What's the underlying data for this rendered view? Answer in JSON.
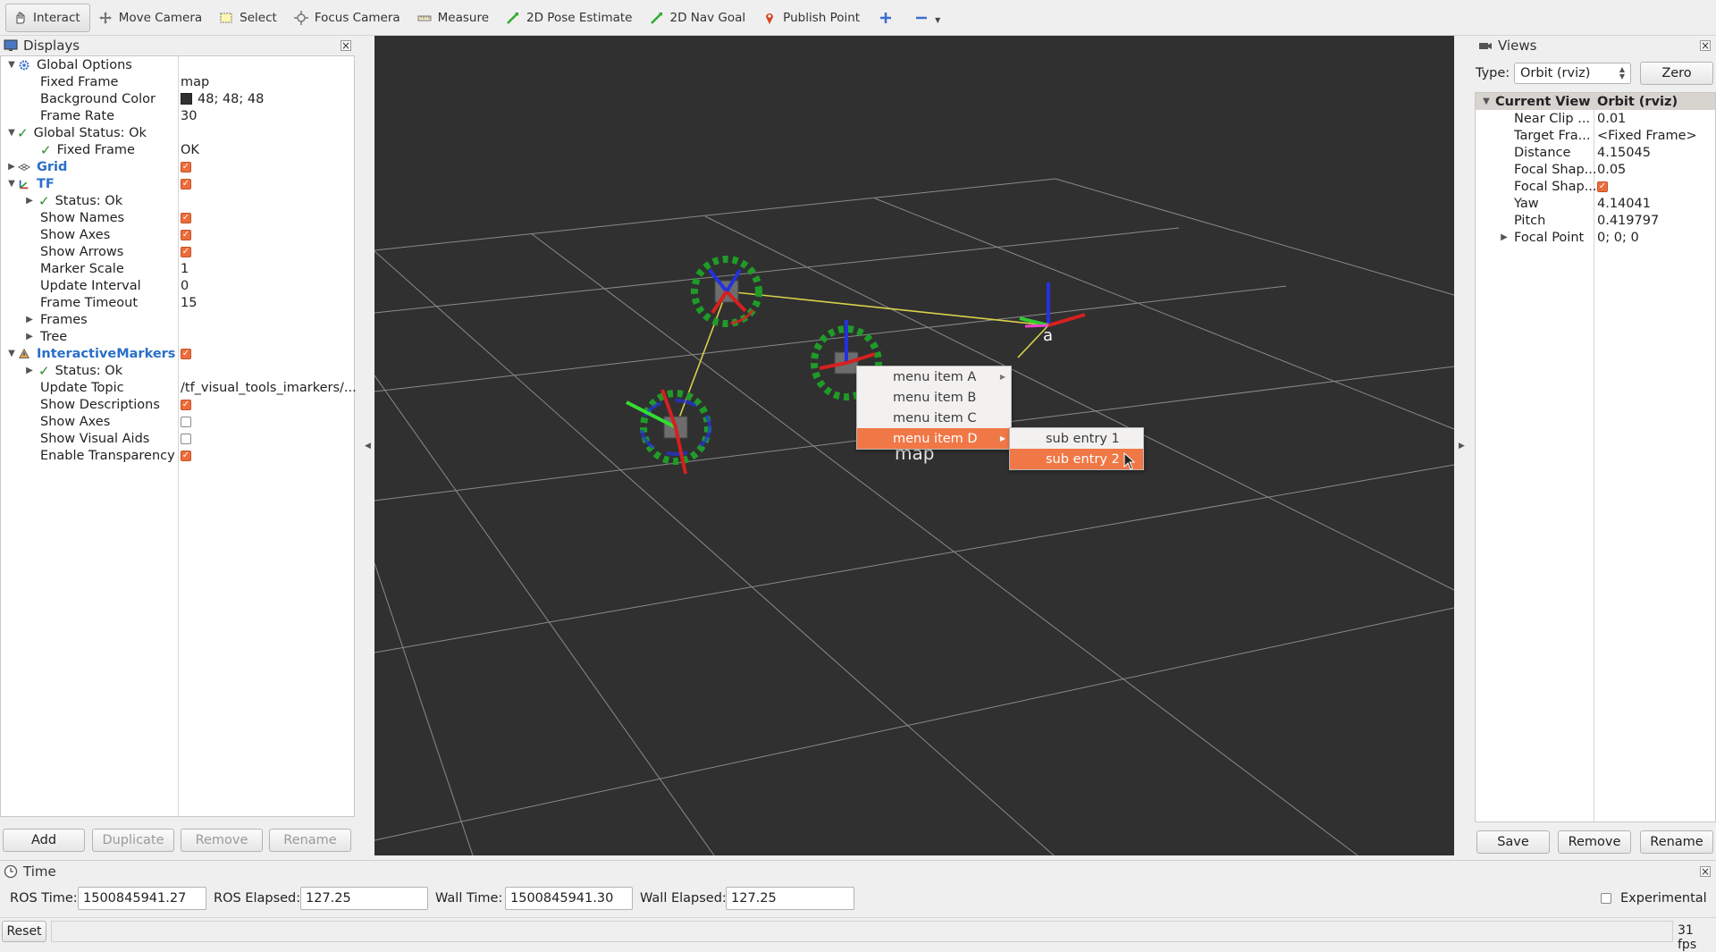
{
  "toolbar": {
    "tools": [
      {
        "label": "Interact",
        "icon": "hand-icon"
      },
      {
        "label": "Move Camera",
        "icon": "move-camera-icon"
      },
      {
        "label": "Select",
        "icon": "select-icon"
      },
      {
        "label": "Focus Camera",
        "icon": "focus-camera-icon"
      },
      {
        "label": "Measure",
        "icon": "measure-icon"
      },
      {
        "label": "2D Pose Estimate",
        "icon": "pose-estimate-icon"
      },
      {
        "label": "2D Nav Goal",
        "icon": "nav-goal-icon"
      },
      {
        "label": "Publish Point",
        "icon": "publish-point-icon"
      }
    ]
  },
  "displays": {
    "title": "Displays",
    "rows": [
      {
        "name": "Global Options",
        "value": ""
      },
      {
        "name": "Fixed Frame",
        "value": "map"
      },
      {
        "name": "Background Color",
        "value": "48; 48; 48"
      },
      {
        "name": "Frame Rate",
        "value": "30"
      },
      {
        "name": "Global Status: Ok",
        "value": ""
      },
      {
        "name": "Fixed Frame",
        "value": "OK"
      },
      {
        "name": "Grid",
        "value": ""
      },
      {
        "name": "TF",
        "value": ""
      },
      {
        "name": "Status: Ok",
        "value": ""
      },
      {
        "name": "Show Names",
        "value": ""
      },
      {
        "name": "Show Axes",
        "value": ""
      },
      {
        "name": "Show Arrows",
        "value": ""
      },
      {
        "name": "Marker Scale",
        "value": "1"
      },
      {
        "name": "Update Interval",
        "value": "0"
      },
      {
        "name": "Frame Timeout",
        "value": "15"
      },
      {
        "name": "Frames",
        "value": ""
      },
      {
        "name": "Tree",
        "value": ""
      },
      {
        "name": "InteractiveMarkers",
        "value": ""
      },
      {
        "name": "Status: Ok",
        "value": ""
      },
      {
        "name": "Update Topic",
        "value": "/tf_visual_tools_imarkers/..."
      },
      {
        "name": "Show Descriptions",
        "value": ""
      },
      {
        "name": "Show Axes",
        "value": ""
      },
      {
        "name": "Show Visual Aids",
        "value": ""
      },
      {
        "name": "Enable Transparency",
        "value": ""
      }
    ],
    "buttons": {
      "add": "Add",
      "duplicate": "Duplicate",
      "remove": "Remove",
      "rename": "Rename"
    }
  },
  "viewport": {
    "frame_label_a": "a",
    "frame_label_map": "map",
    "background": "#303030"
  },
  "context_menu": {
    "items": [
      "menu item A",
      "menu item B",
      "menu item C",
      "menu item D"
    ],
    "selected": "menu item D",
    "submenu": [
      "sub entry 1",
      "sub entry 2"
    ],
    "submenu_selected": "sub entry 2"
  },
  "views": {
    "title": "Views",
    "type_label": "Type:",
    "type_value": "Orbit (rviz)",
    "zero_label": "Zero",
    "header": {
      "name": "Current View",
      "value": "Orbit (rviz)"
    },
    "rows": [
      {
        "name": "Near Clip ...",
        "value": "0.01"
      },
      {
        "name": "Target Fra...",
        "value": "<Fixed Frame>"
      },
      {
        "name": "Distance",
        "value": "4.15045"
      },
      {
        "name": "Focal Shap...",
        "value": "0.05"
      },
      {
        "name": "Focal Shap...",
        "value": ""
      },
      {
        "name": "Yaw",
        "value": "4.14041"
      },
      {
        "name": "Pitch",
        "value": "0.419797"
      },
      {
        "name": "Focal Point",
        "value": "0; 0; 0"
      }
    ],
    "buttons": {
      "save": "Save",
      "remove": "Remove",
      "rename": "Rename"
    }
  },
  "time": {
    "title": "Time",
    "ros_time_label": "ROS Time:",
    "ros_time": "1500845941.27",
    "ros_elapsed_label": "ROS Elapsed:",
    "ros_elapsed": "127.25",
    "wall_time_label": "Wall Time:",
    "wall_time": "1500845941.30",
    "wall_elapsed_label": "Wall Elapsed:",
    "wall_elapsed": "127.25",
    "experimental_label": "Experimental"
  },
  "status_bar": {
    "reset": "Reset",
    "fps": "31 fps"
  },
  "colors": {
    "accent": "#f07746",
    "status_ok": "#2a8a2a",
    "link_blue": "#2a6fc8"
  }
}
